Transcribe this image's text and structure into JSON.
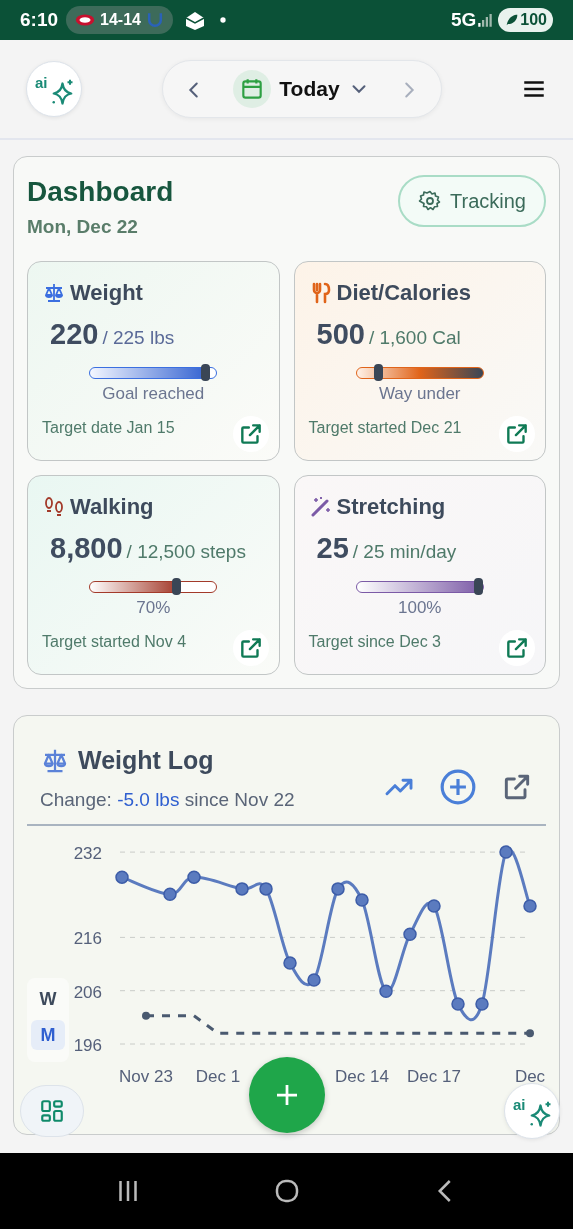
{
  "status_bar": {
    "time": "6:10",
    "score": "14-14",
    "network": "5G",
    "battery": "100"
  },
  "header": {
    "ai_label": "ai",
    "date_label": "Today"
  },
  "dashboard": {
    "title": "Dashboard",
    "date": "Mon, Dec 22",
    "tracking_button": "Tracking",
    "cards": [
      {
        "kind": "weight",
        "title": "Weight",
        "value": "220",
        "target": "/ 225 lbs",
        "level": 0.95,
        "status": "Goal reached",
        "footer": "Target date Jan 15",
        "color": "#3b6fe0"
      },
      {
        "kind": "diet",
        "title": "Diet/Calories",
        "value": "500",
        "target": "/ 1,600 Cal",
        "level": 0.15,
        "status": "Way under",
        "footer": "Target started Dec 21",
        "color": "#e0641a"
      },
      {
        "kind": "walking",
        "title": "Walking",
        "value": "8,800",
        "target": "/ 12,500 steps",
        "level": 0.7,
        "status": "70%",
        "footer": "Target started Nov 4",
        "color": "#a33a2a"
      },
      {
        "kind": "stretching",
        "title": "Stretching",
        "value": "25",
        "target": "/ 25 min/day",
        "level": 1.0,
        "status": "100%",
        "footer": "Target since Dec 3",
        "color": "#7b5aa6"
      }
    ]
  },
  "weight_log": {
    "title": "Weight Log",
    "change_prefix": "Change:",
    "change_value": "-5.0 lbs",
    "change_suffix": "since Nov 22",
    "range_toggle": [
      {
        "label": "W",
        "selected": false
      },
      {
        "label": "M",
        "selected": true
      }
    ],
    "chart_data": {
      "type": "line",
      "categories": [
        null,
        "Nov 23",
        null,
        null,
        "Dec 1",
        null,
        null,
        null,
        null,
        null,
        "Dec 14",
        null,
        null,
        "Dec 17",
        null,
        null,
        null,
        "Dec"
      ],
      "grid": true,
      "ylim": [
        196,
        232
      ],
      "yticks": [
        196,
        206,
        216,
        232
      ],
      "series": [
        {
          "color": "#5b7bbf",
          "marker": "circle",
          "values": [
            227.3,
            null,
            224.1,
            227.3,
            null,
            225.1,
            225.1,
            211.2,
            208.0,
            225.1,
            223.0,
            205.9,
            216.6,
            221.9,
            203.5,
            203.5,
            232.0,
            221.9
          ]
        },
        {
          "color": "#4a5a70",
          "line_style": "dashed",
          "values": [
            null,
            201.3,
            201.3,
            201.3,
            198,
            198,
            198,
            198,
            198,
            198,
            198,
            198,
            198,
            198,
            198,
            198,
            198,
            198
          ]
        }
      ]
    }
  },
  "floating": {
    "ai_label": "ai"
  }
}
